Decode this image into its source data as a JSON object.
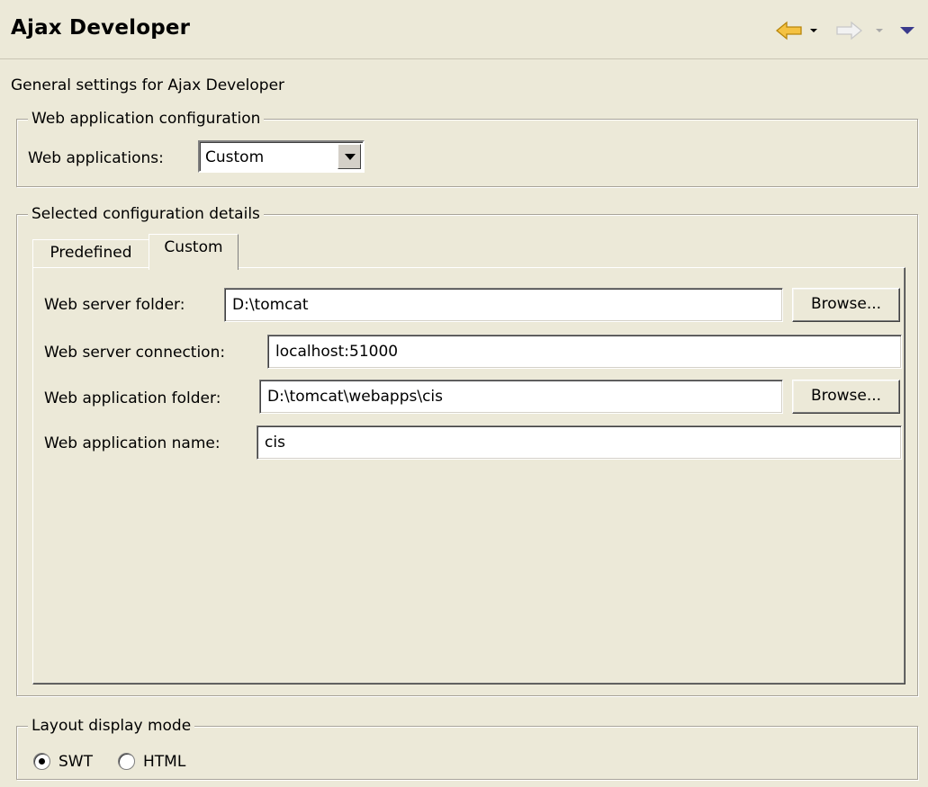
{
  "header": {
    "title": "Ajax Developer",
    "icons": [
      "back-arrow-icon",
      "dropdown-icon",
      "forward-arrow-icon",
      "view-menu-icon"
    ]
  },
  "description": "General settings for Ajax Developer",
  "web_app_config": {
    "legend": "Web application configuration",
    "label": "Web applications:",
    "selected": "Custom"
  },
  "config_details": {
    "legend": "Selected configuration details",
    "tabs": [
      {
        "label": "Predefined",
        "active": false
      },
      {
        "label": "Custom",
        "active": true
      }
    ],
    "fields": [
      {
        "label": "Web server folder:",
        "value": "D:\\tomcat",
        "button": "Browse..."
      },
      {
        "label": "Web server connection:",
        "value": "localhost:51000"
      },
      {
        "label": "Web application folder:",
        "value": "D:\\tomcat\\webapps\\cis",
        "button": "Browse..."
      },
      {
        "label": "Web application name:",
        "value": "cis"
      }
    ]
  },
  "layout_mode": {
    "legend": "Layout display mode",
    "options": [
      {
        "label": "SWT",
        "checked": true
      },
      {
        "label": "HTML",
        "checked": false
      }
    ]
  },
  "colors": {
    "background": "#ece9d8",
    "back_arrow": "#f5c242",
    "view_menu": "#3a3a8c"
  }
}
